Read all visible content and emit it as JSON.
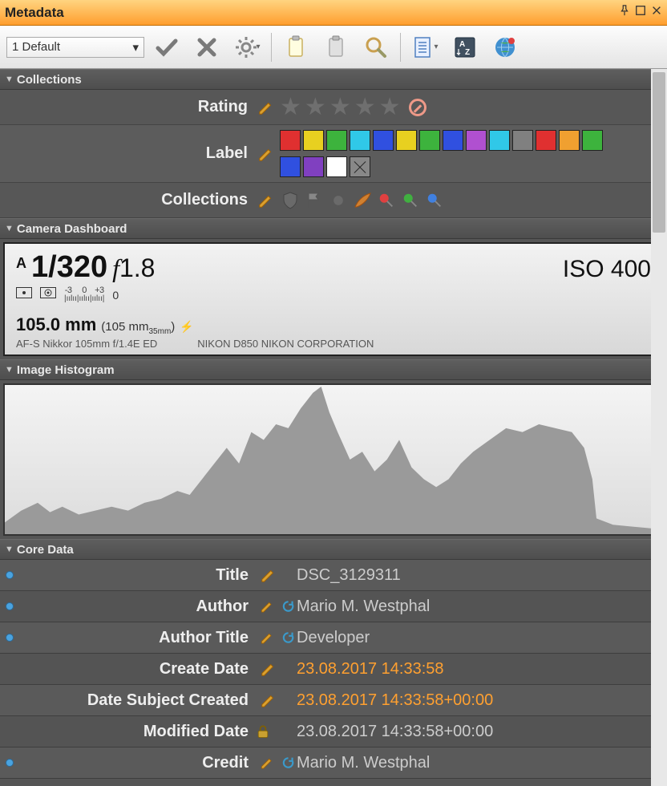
{
  "window": {
    "title": "Metadata"
  },
  "toolbar": {
    "layout_name": "1 Default"
  },
  "sections": {
    "collections": "Collections",
    "camera": "Camera Dashboard",
    "histogram": "Image Histogram",
    "core": "Core Data"
  },
  "collections": {
    "rating_label": "Rating",
    "label_label": "Label",
    "collections_label": "Collections",
    "label_colors_row1": [
      "#e03030",
      "#e8d020",
      "#3db33d",
      "#30c8e8",
      "#3050e0",
      "#e8d020",
      "#3db33d",
      "#3050e0",
      "#b050d0",
      "#30c8e8",
      "#808080",
      "#e03030",
      "#f0a030",
      "#3db33d"
    ],
    "label_colors_row2": [
      "#3050e0",
      "#8040c0",
      "#ffffff"
    ]
  },
  "camera": {
    "mode": "A",
    "shutter": "1/320",
    "aperture_f": "f",
    "aperture_num": " 1.8",
    "iso": "ISO 400",
    "ev_scale_labels": "-3     0    +3",
    "ev_value": "0",
    "ev_ticks": "|ıılıı|ıılıı|ıılıı|",
    "focal": "105.0 mm",
    "focal35_prefix": "(105 mm",
    "focal35_suffix": "35mm",
    "focal35_close": ")",
    "lens": "AF-S Nikkor 105mm f/1.4E ED",
    "body": "NIKON D850 NIKON CORPORATION"
  },
  "core": {
    "rows": [
      {
        "label": "Title",
        "value": "DSC_3129311",
        "orange": false,
        "pencil": true,
        "refresh": false,
        "info": true
      },
      {
        "label": "Author",
        "value": "Mario M. Westphal",
        "orange": false,
        "pencil": true,
        "refresh": true,
        "info": true
      },
      {
        "label": "Author Title",
        "value": "Developer",
        "orange": false,
        "pencil": true,
        "refresh": true,
        "info": true
      },
      {
        "label": "Create Date",
        "value": "23.08.2017 14:33:58",
        "orange": true,
        "pencil": true,
        "refresh": false,
        "info": false
      },
      {
        "label": "Date Subject Created",
        "value": "23.08.2017 14:33:58+00:00",
        "orange": true,
        "pencil": true,
        "refresh": false,
        "info": false
      },
      {
        "label": "Modified Date",
        "value": "23.08.2017 14:33:58+00:00",
        "orange": false,
        "pencil": false,
        "lock": true,
        "info": false
      },
      {
        "label": "Credit",
        "value": "Mario M. Westphal",
        "orange": false,
        "pencil": true,
        "refresh": true,
        "info": true
      }
    ]
  }
}
